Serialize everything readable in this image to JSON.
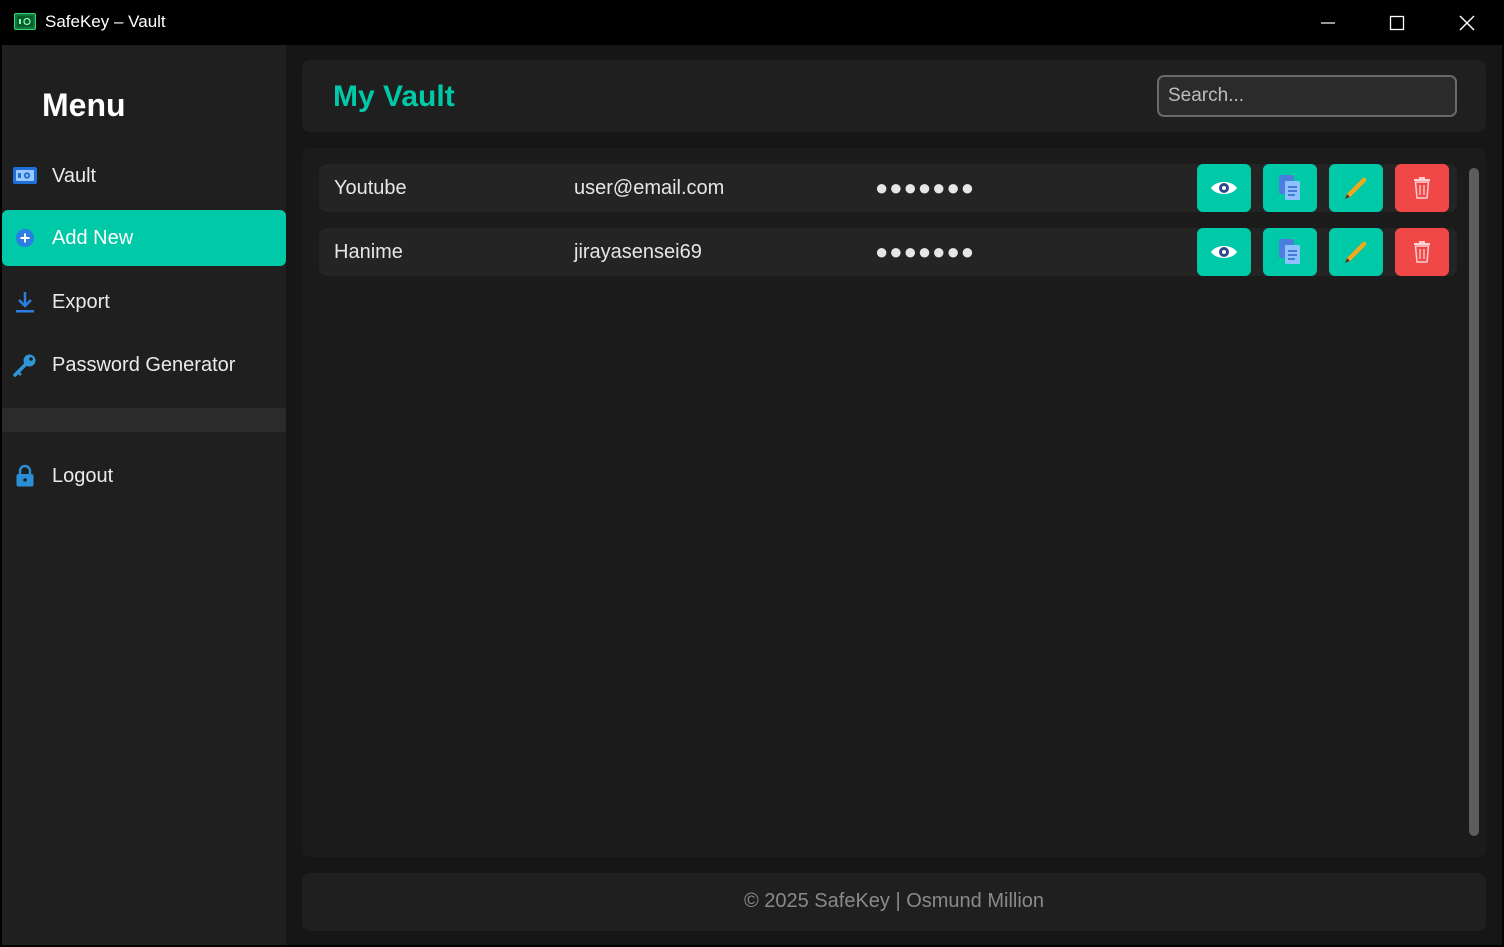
{
  "window": {
    "title": "SafeKey – Vault",
    "icon": "safe-app-icon",
    "controls": [
      "minimize-icon",
      "maximize-icon",
      "close-icon"
    ]
  },
  "sidebar": {
    "title": "Menu",
    "items": [
      {
        "label": "Vault",
        "icon": "vault-safe-icon",
        "active": false
      },
      {
        "label": "Add New",
        "icon": "plus-circle-icon",
        "active": true
      },
      {
        "label": "Export",
        "icon": "download-icon",
        "active": false
      },
      {
        "label": "Password Generator",
        "icon": "key-icon",
        "active": false
      }
    ],
    "logout": {
      "label": "Logout",
      "icon": "lock-icon"
    }
  },
  "header": {
    "title": "My Vault",
    "search_placeholder": "Search..."
  },
  "entries": [
    {
      "site": "Youtube",
      "username": "user@email.com",
      "password_mask": "●●●●●●●"
    },
    {
      "site": "Hanime",
      "username": "jirayasensei69",
      "password_mask": "●●●●●●●"
    }
  ],
  "row_actions": [
    "eye-icon",
    "copy-icon",
    "pencil-icon",
    "trash-icon"
  ],
  "footer": {
    "text": "© 2025 SafeKey | Osmund Million"
  },
  "colors": {
    "accent": "#00c9a7",
    "danger": "#f04747",
    "sidebar_bg": "#1f1f1f",
    "main_bg": "#161616"
  }
}
